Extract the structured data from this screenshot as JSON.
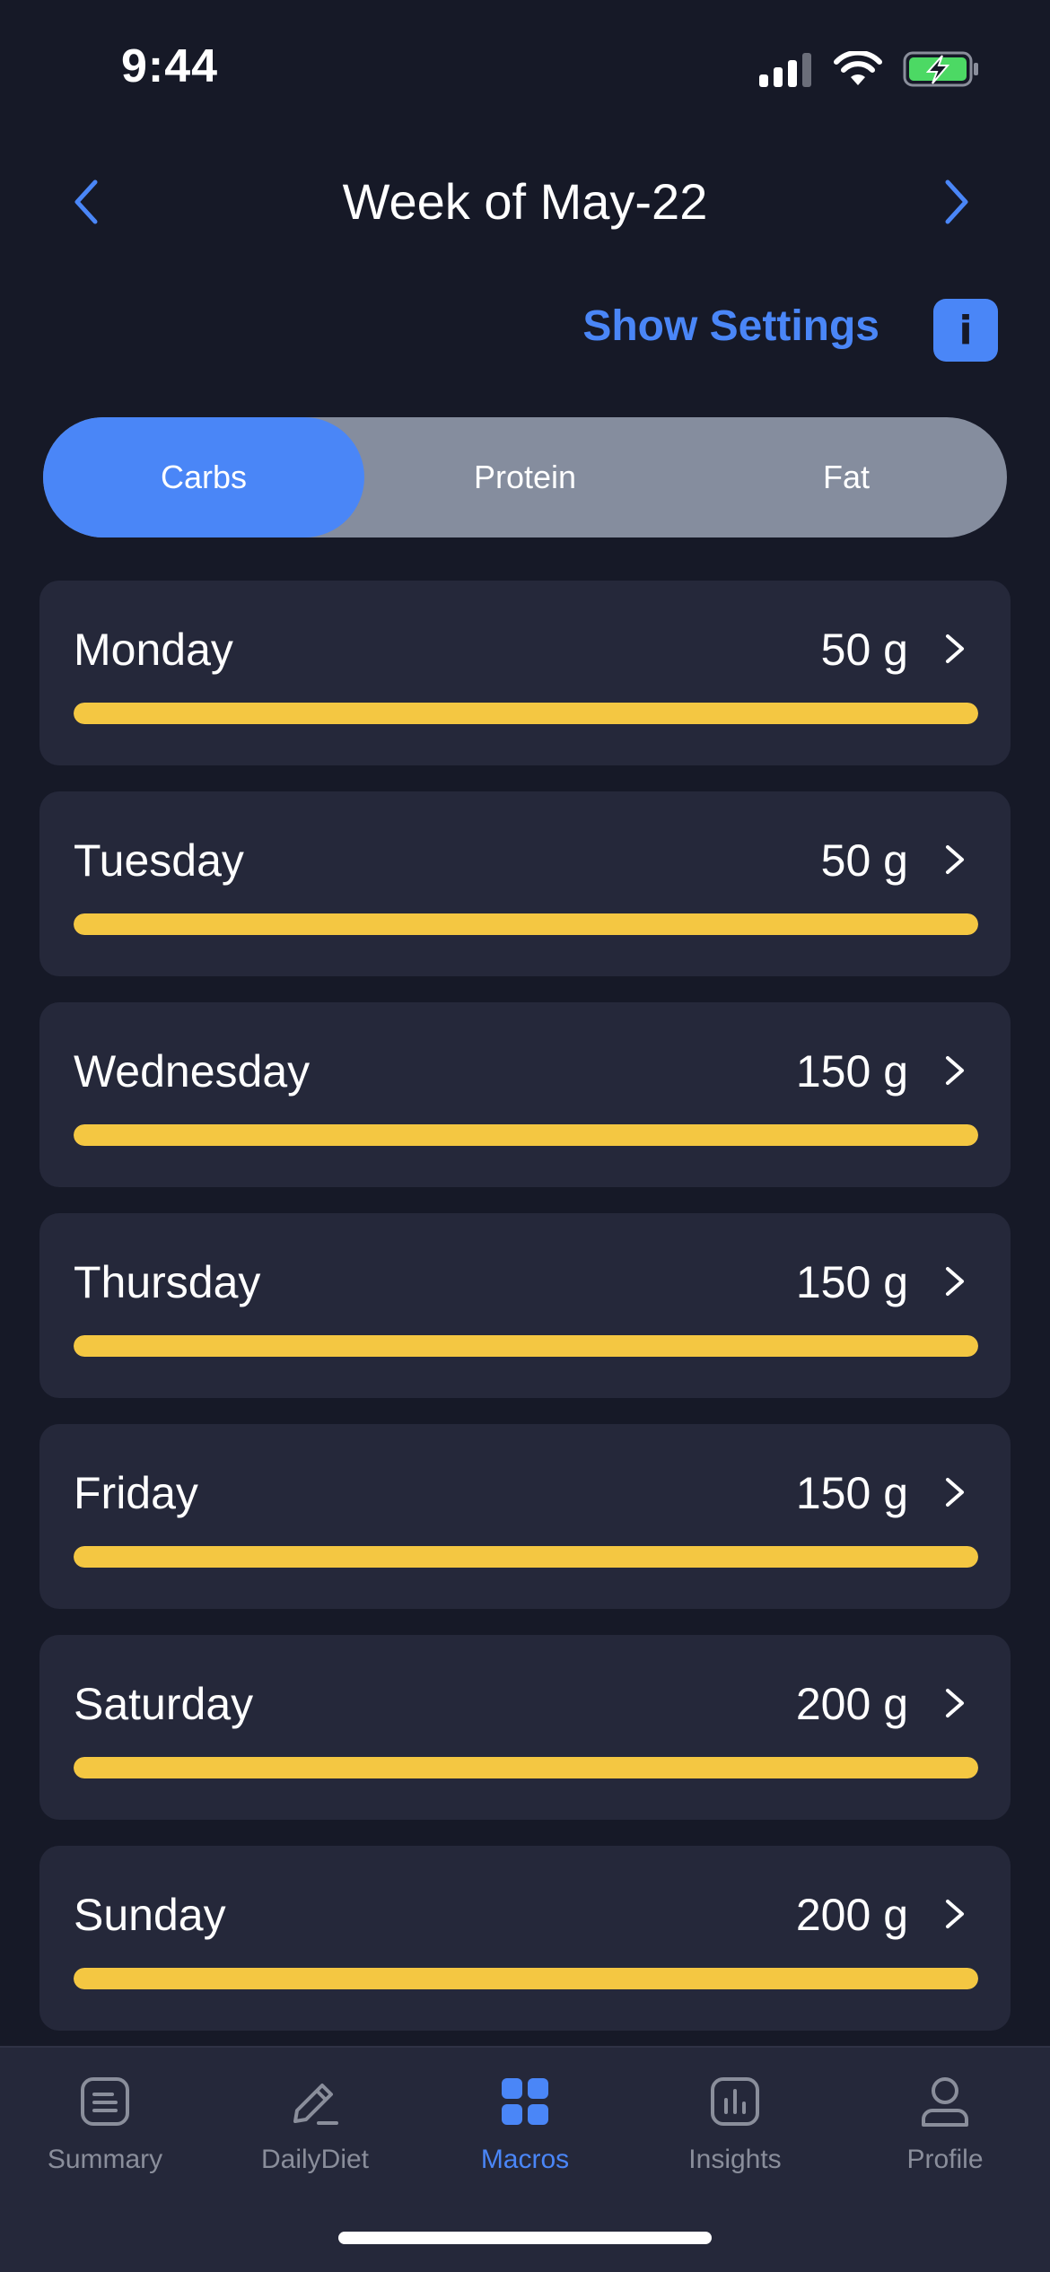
{
  "status_bar": {
    "time": "9:44"
  },
  "header": {
    "title": "Week of May-22"
  },
  "settings": {
    "link_label": "Show Settings",
    "info_label": "i"
  },
  "segments": [
    {
      "label": "Carbs",
      "active": true
    },
    {
      "label": "Protein",
      "active": false
    },
    {
      "label": "Fat",
      "active": false
    }
  ],
  "days": [
    {
      "name": "Monday",
      "value": "50 g",
      "progress": 1.0
    },
    {
      "name": "Tuesday",
      "value": "50 g",
      "progress": 1.0
    },
    {
      "name": "Wednesday",
      "value": "150 g",
      "progress": 1.0
    },
    {
      "name": "Thursday",
      "value": "150 g",
      "progress": 1.0
    },
    {
      "name": "Friday",
      "value": "150 g",
      "progress": 1.0
    },
    {
      "name": "Saturday",
      "value": "200 g",
      "progress": 1.0
    },
    {
      "name": "Sunday",
      "value": "200 g",
      "progress": 1.0
    }
  ],
  "tabs": [
    {
      "label": "Summary",
      "icon": "document-icon",
      "active": false
    },
    {
      "label": "DailyDiet",
      "icon": "pencil-icon",
      "active": false
    },
    {
      "label": "Macros",
      "icon": "grid-icon",
      "active": true
    },
    {
      "label": "Insights",
      "icon": "bar-chart-icon",
      "active": false
    },
    {
      "label": "Profile",
      "icon": "person-icon",
      "active": false
    }
  ],
  "colors": {
    "background": "#161927",
    "card": "#25283a",
    "accent": "#4a86f7",
    "progress": "#f4c742",
    "segment_inactive": "#858d9e"
  }
}
